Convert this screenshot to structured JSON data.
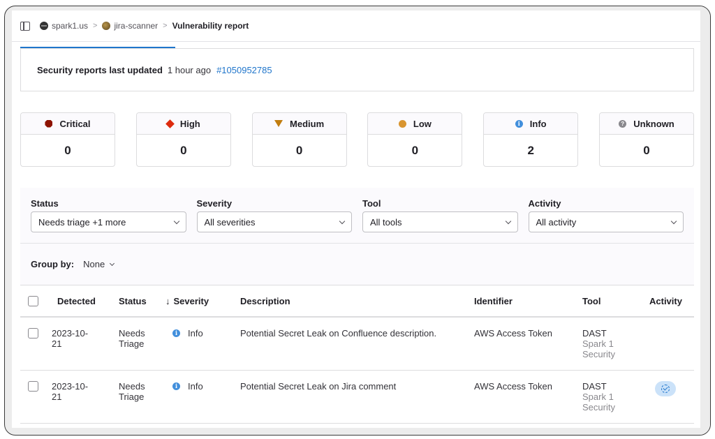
{
  "breadcrumb": {
    "items": [
      {
        "label": "spark1.us",
        "icon": "group-avatar"
      },
      {
        "label": "jira-scanner",
        "icon": "project-avatar"
      }
    ],
    "current": "Vulnerability report",
    "separator": ">"
  },
  "loading_progress_percent": 23,
  "report": {
    "label": "Security reports last updated",
    "time": "1 hour ago",
    "pipeline_link": "#1050952785"
  },
  "severity_cards": [
    {
      "label": "Critical",
      "count": "0",
      "icon": "critical-octagon",
      "color": "#8d1300"
    },
    {
      "label": "High",
      "count": "0",
      "icon": "high-diamond",
      "color": "#dd2b0e"
    },
    {
      "label": "Medium",
      "count": "0",
      "icon": "medium-triangle",
      "color": "#c17d10"
    },
    {
      "label": "Low",
      "count": "0",
      "icon": "low-circle",
      "color": "#d99530"
    },
    {
      "label": "Info",
      "count": "2",
      "icon": "info-circle",
      "color": "#428fdc"
    },
    {
      "label": "Unknown",
      "count": "0",
      "icon": "question-circle",
      "color": "#89888d"
    }
  ],
  "filters": [
    {
      "label": "Status",
      "value": "Needs triage +1 more"
    },
    {
      "label": "Severity",
      "value": "All severities"
    },
    {
      "label": "Tool",
      "value": "All tools"
    },
    {
      "label": "Activity",
      "value": "All activity"
    }
  ],
  "group_by": {
    "label": "Group by:",
    "value": "None"
  },
  "table": {
    "columns": [
      "Detected",
      "Status",
      "Severity",
      "Description",
      "Identifier",
      "Tool",
      "Activity"
    ],
    "sort_indicator": "↓",
    "rows": [
      {
        "detected": "2023-10-21",
        "detected_line1": "2023-10-",
        "detected_line2": "21",
        "status_line1": "Needs",
        "status_line2": "Triage",
        "severity": "Info",
        "description": "Potential Secret Leak on Confluence description.",
        "identifier": "AWS Access Token",
        "tool": "DAST",
        "tool_sub1": "Spark 1",
        "tool_sub2": "Security",
        "activity": ""
      },
      {
        "detected": "2023-10-21",
        "detected_line1": "2023-10-",
        "detected_line2": "21",
        "status_line1": "Needs",
        "status_line2": "Triage",
        "severity": "Info",
        "description": "Potential Secret Leak on Jira comment",
        "identifier": "AWS Access Token",
        "tool": "DAST",
        "tool_sub1": "Spark 1",
        "tool_sub2": "Security",
        "activity": "resolved-on-default-branch-icon"
      }
    ]
  },
  "colors": {
    "accent_link": "#1f75cb",
    "info": "#428fdc"
  }
}
